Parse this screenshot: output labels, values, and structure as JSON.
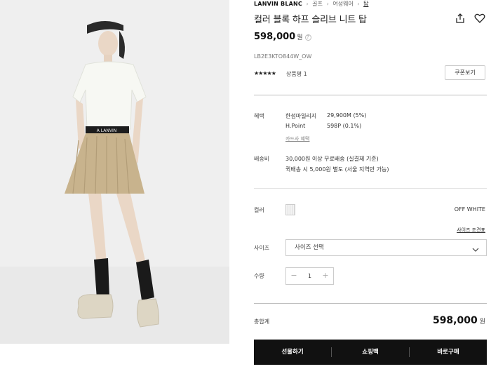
{
  "breadcrumb": {
    "brand": "LANVIN BLANC",
    "items": [
      "골프",
      "여성웨어",
      "탑"
    ]
  },
  "product": {
    "title": "컬러 블록 하프 슬리브 니트 탑",
    "price": "598,000",
    "price_unit": "원",
    "code": "LB2E3KTO844W_OW",
    "stars": "★★★★★",
    "review_label": "상품평 1",
    "coupon_button": "쿠폰보기"
  },
  "benefits": {
    "label": "혜택",
    "rows": [
      {
        "name": "한섬마일리지",
        "value": "29,900M (5%)"
      },
      {
        "name": "H.Point",
        "value": "598P (0.1%)"
      }
    ],
    "card_link": "카드사 혜택"
  },
  "shipping": {
    "label": "배송비",
    "line1": "30,000원 이상 무료배송 (실결제 기준)",
    "line2": "퀵배송 시 5,000원 별도 (서울 지역만 가능)"
  },
  "color": {
    "label": "컬러",
    "selected": "OFF WHITE",
    "size_guide": "사이즈 조견표"
  },
  "size": {
    "label": "사이즈",
    "placeholder": "사이즈 선택"
  },
  "quantity": {
    "label": "수량",
    "value": "1",
    "minus": "−",
    "plus": "+"
  },
  "total": {
    "label": "총합계",
    "value": "598,000",
    "unit": "원"
  },
  "actions": {
    "gift": "선물하기",
    "bag": "쇼핑백",
    "buy": "바로구매"
  },
  "colors": {
    "accent": "#111111",
    "swatch": "#f4f4f4"
  }
}
